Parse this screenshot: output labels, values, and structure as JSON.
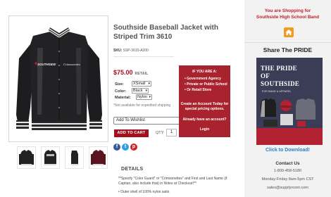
{
  "product": {
    "title": "Southside Baseball Jacket with Striped Trim 3610",
    "sku_label": "SKU:",
    "sku_value": "SSP-3610-A200",
    "price": "$75.00",
    "price_tag": "RETAIL",
    "size_label": "Size:",
    "size_value": "XSmall",
    "color_label": "Color:",
    "color_value": "Black",
    "material_label": "Material:",
    "material_value": "Nylon",
    "shipping_note": "*Not available for expedited shipping",
    "wishlist_label": "Add To Wishlist",
    "add_to_cart": "ADD TO CART",
    "qty_label": "QTY:",
    "qty_value": "1",
    "jacket_text_left": "SOUTHSIDE",
    "jacket_text_right": "Crimsonettes"
  },
  "details": {
    "title": "DETAILS",
    "note": "**Specify \"Color Guard\" or \"Crimsonettes\" and First and Last Name (if Captian, also include that) in Notes at Checkout!**",
    "bullet": "• Outer shell of 100% nylon satin"
  },
  "promo": {
    "heading": "IF YOU ARE A:",
    "items": [
      "• Government Agency",
      "• Private or Public School",
      "• Or Retail Store"
    ],
    "cta": "Create an Account Today for special pricing options.",
    "already": "Already have an account?",
    "login": "Login"
  },
  "sidebar": {
    "shopping_line1": "You are Shopping for",
    "shopping_line2": "Southside High School Band",
    "share_title": "Share The PRIDE",
    "pride_line1": "THE PRIDE",
    "pride_line2": "OF",
    "pride_line3": "SOUTHSIDE",
    "pride_sub": "FOR BAND & APPAREL",
    "download": "Click to Download!",
    "contact_title": "Contact Us",
    "phone": "1-800-458-5180",
    "hours": "Monday-Friday 8am-5pm CST",
    "email": "sales@supplyroom.com"
  },
  "colors": {
    "brand_red": "#a30f1f",
    "promo_red": "#a8232e",
    "link_blue": "#2a7fc9",
    "home_orange": "#f29a1f"
  },
  "icons": [
    "home-icon",
    "facebook-icon",
    "twitter-icon",
    "pinterest-icon",
    "caret-down-icon"
  ]
}
